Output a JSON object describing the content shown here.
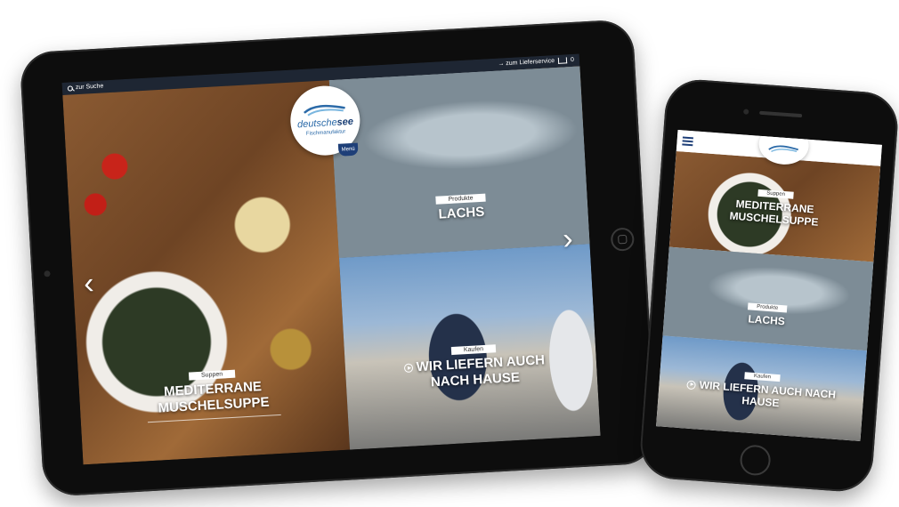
{
  "tablet": {
    "topbar": {
      "search_label": "zur Suche",
      "delivery_link": "→ zum Lieferservice",
      "cart_count": "0"
    },
    "logo": {
      "name_light": "deutsche",
      "name_bold": "see",
      "subtitle": "Fischmanufaktur",
      "menu_label": "Menü"
    },
    "tiles": [
      {
        "tag": "Suppen",
        "title_line1": "MEDITERRANE",
        "title_line2": "MUSCHELSUPPE"
      },
      {
        "tag": "Produkte",
        "title_line1": "LACHS"
      },
      {
        "tag": "Kaufen",
        "title_line1": "WIR LIEFERN AUCH",
        "title_line2": "NACH HAUSE"
      }
    ],
    "arrows": {
      "prev": "‹",
      "next": "›"
    }
  },
  "phone": {
    "tiles": [
      {
        "tag": "Suppen",
        "title_line1": "MEDITERRANE",
        "title_line2": "MUSCHELSUPPE"
      },
      {
        "tag": "Produkte",
        "title_line1": "LACHS"
      },
      {
        "tag": "Kaufen",
        "title_line1": "WIR LIEFERN AUCH NACH",
        "title_line2": "HAUSE"
      }
    ]
  },
  "colors": {
    "brand_blue": "#1e3f78",
    "logo_blue": "#2b6aa8",
    "topbar": "#1e2633"
  }
}
